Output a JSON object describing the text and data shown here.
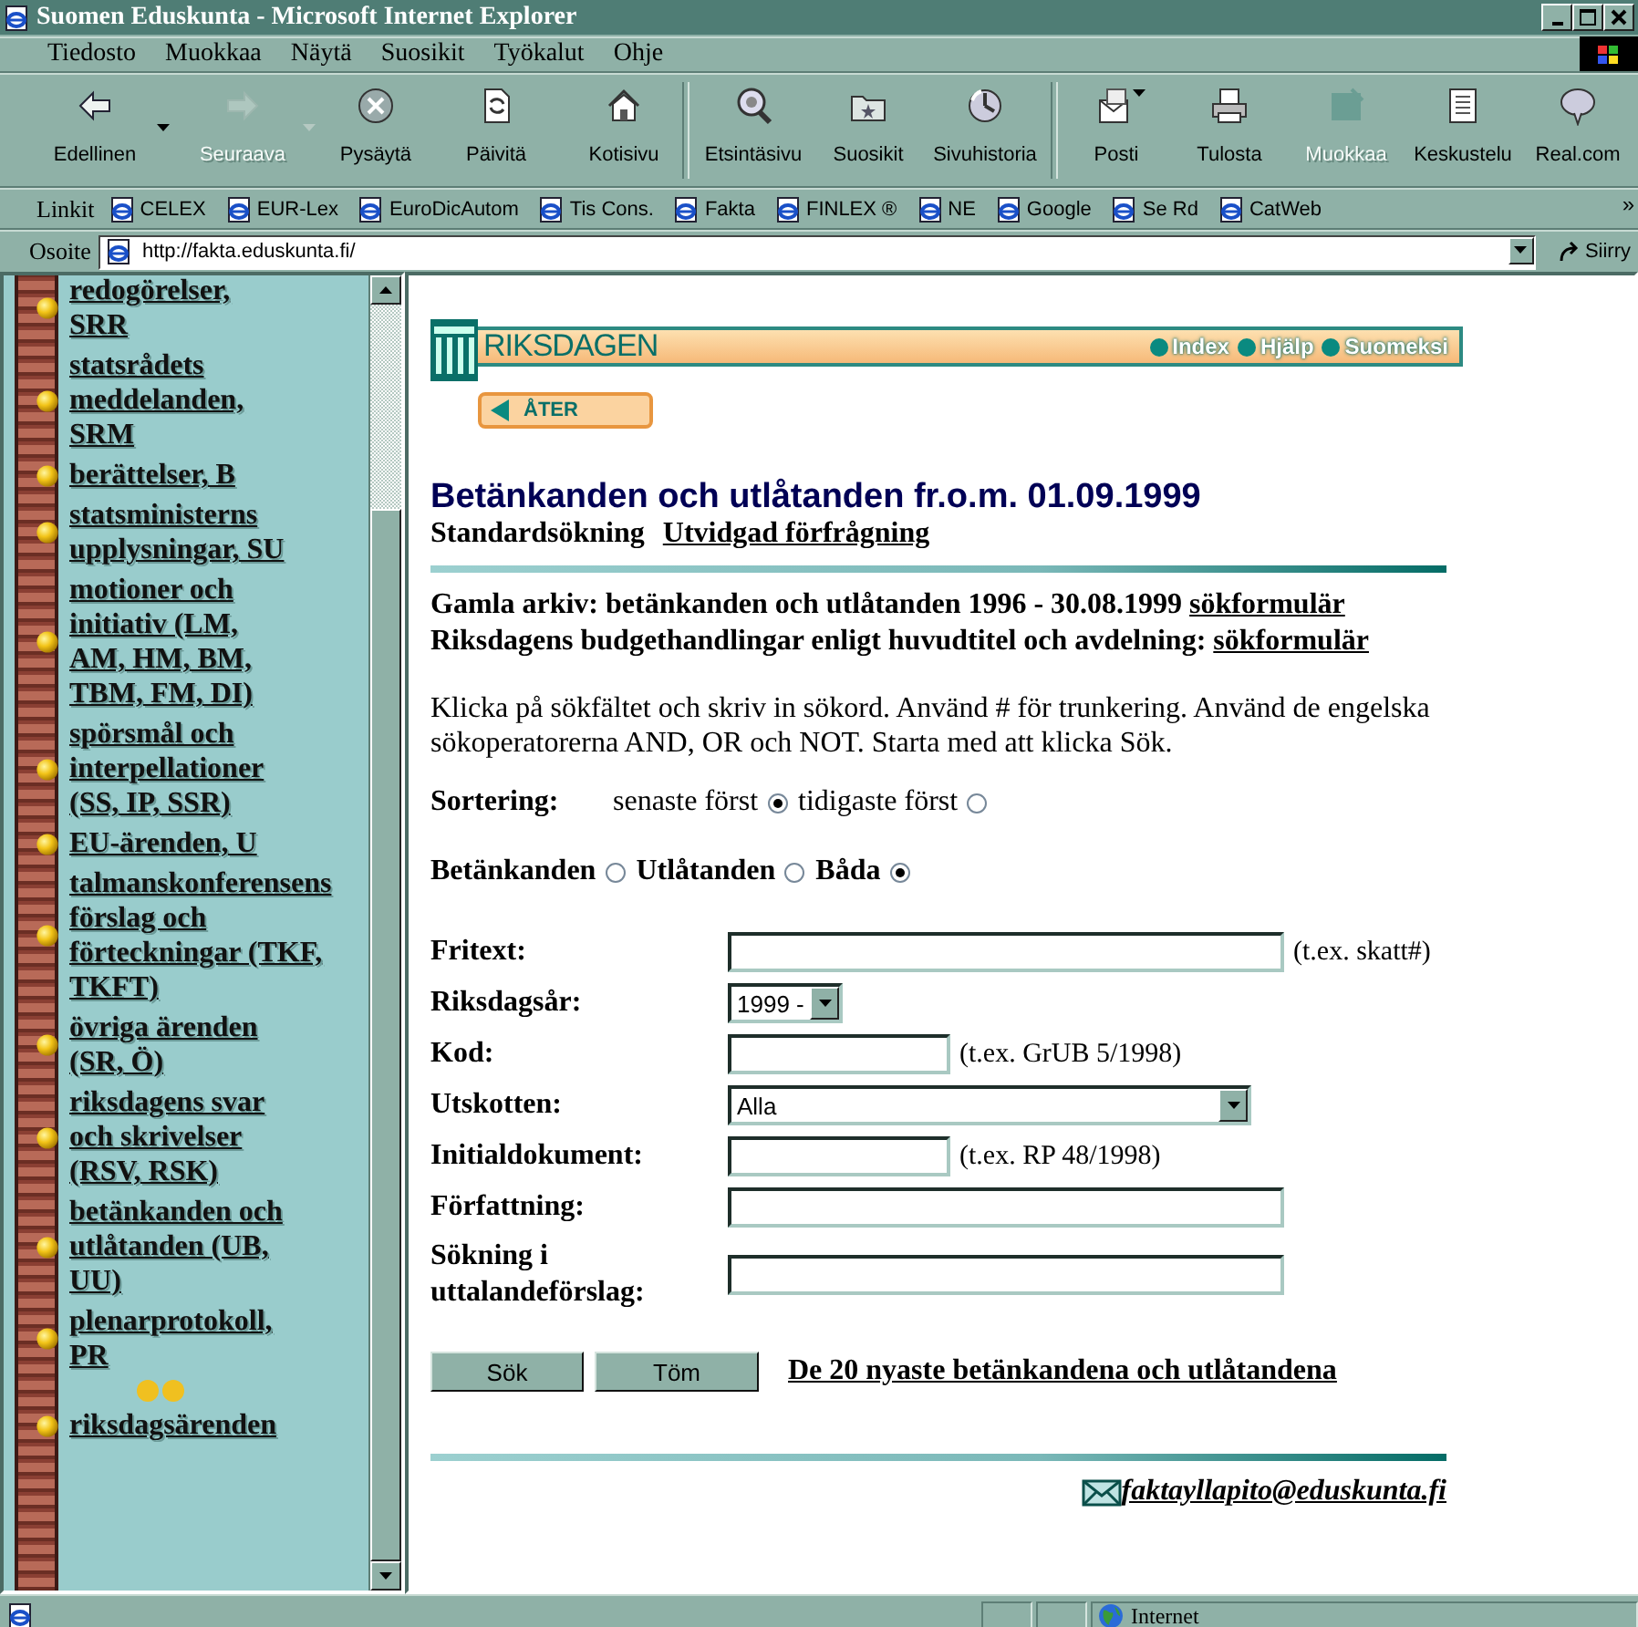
{
  "window": {
    "title": "Suomen Eduskunta - Microsoft Internet Explorer"
  },
  "menu": [
    "Tiedosto",
    "Muokkaa",
    "Näytä",
    "Suosikit",
    "Työkalut",
    "Ohje"
  ],
  "toolbar": [
    {
      "label": "Edellinen",
      "disabled": false
    },
    {
      "label": "Seuraava",
      "disabled": true
    },
    {
      "label": "Pysäytä",
      "disabled": false
    },
    {
      "label": "Päivitä",
      "disabled": false
    },
    {
      "label": "Kotisivu",
      "disabled": false
    },
    {
      "label": "Etsintäsivu",
      "disabled": false
    },
    {
      "label": "Suosikit",
      "disabled": false
    },
    {
      "label": "Sivuhistoria",
      "disabled": false
    },
    {
      "label": "Posti",
      "disabled": false
    },
    {
      "label": "Tulosta",
      "disabled": false
    },
    {
      "label": "Muokkaa",
      "disabled": true
    },
    {
      "label": "Keskustelu",
      "disabled": false
    },
    {
      "label": "Real.com",
      "disabled": false
    }
  ],
  "links_bar": {
    "label": "Linkit",
    "links": [
      "CELEX",
      "EUR-Lex",
      "EuroDicAutom",
      "Tis Cons.",
      "Fakta",
      "FINLEX ®",
      "NE",
      "Google",
      "Se Rd",
      "CatWeb"
    ],
    "more": "»"
  },
  "address_bar": {
    "label": "Osoite",
    "value": "http://fakta.eduskunta.fi/",
    "go": "Siirry"
  },
  "sidebar": {
    "items": [
      "redogörelser, SRR",
      "statsrådets meddelanden, SRM",
      "berättelser, B",
      "statsministerns upplysningar, SU",
      "motioner och initiativ (LM, AM, HM, BM, TBM, FM, DI)",
      "spörsmål och interpellationer (SS, IP, SSR)",
      "EU-ärenden, U",
      "talmanskonferensens förslag och förteckningar (TKF, TKFT)",
      "övriga ärenden (SR, Ö)",
      "riksdagens svar och skrivelser (RSV, RSK)",
      "betänkanden och utlåtanden (UB, UU)",
      "plenarprotokoll, PR",
      "riksdagsärenden"
    ]
  },
  "banner": {
    "title": "RIKSDAGEN",
    "nav": [
      "Index",
      "Hjälp",
      "Suomeksi"
    ],
    "back": "ÅTER"
  },
  "heading": "Betänkanden och utlåtanden fr.o.m. 01.09.1999",
  "search_tabs": [
    {
      "label": "Standardsökning",
      "selected": true
    },
    {
      "label": "Utvidgad förfrågning",
      "selected": false
    }
  ],
  "archive_lines": [
    {
      "text": "Gamla arkiv: betänkanden och utlåtanden 1996 - 30.08.1999",
      "link": "sökformulär"
    },
    {
      "text": "Riksdagens budgethandlingar enligt huvudtitel och avdelning:",
      "link": "sökformulär"
    }
  ],
  "instructions": "Klicka på sökfältet och skriv in sökord. Använd # för trunkering. Använd de engelska sökoperatorerna AND, OR och NOT. Starta med att klicka Sök.",
  "sort": {
    "label": "Sortering:",
    "options": [
      {
        "label": "senaste först",
        "selected": true
      },
      {
        "label": "tidigaste först",
        "selected": false
      }
    ]
  },
  "doc_types": [
    {
      "label": "Betänkanden",
      "selected": false
    },
    {
      "label": "Utlåtanden",
      "selected": false
    },
    {
      "label": "Båda",
      "selected": true
    }
  ],
  "form": {
    "rows": [
      {
        "label": "Fritext:",
        "kind": "text_long",
        "hint": "(t.ex. skatt#)"
      },
      {
        "label": "Riksdagsår:",
        "kind": "select_short",
        "value": "1999 -"
      },
      {
        "label": "Kod:",
        "kind": "text_short",
        "hint": "(t.ex. GrUB 5/1998)"
      },
      {
        "label": "Utskotten:",
        "kind": "select_long",
        "value": "Alla"
      },
      {
        "label": "Initialdokument:",
        "kind": "text_short",
        "hint": "(t.ex. RP 48/1998)"
      },
      {
        "label": "Författning:",
        "kind": "text_long"
      },
      {
        "label": "Sökning i uttalandeförslag:",
        "kind": "text_long"
      }
    ]
  },
  "buttons": [
    "Sök",
    "Töm"
  ],
  "latest_link": "De 20 nyaste betänkandena och utlåtandena",
  "contact_email": "faktayllapito@eduskunta.fi",
  "status_bar": {
    "zone": "Internet"
  }
}
